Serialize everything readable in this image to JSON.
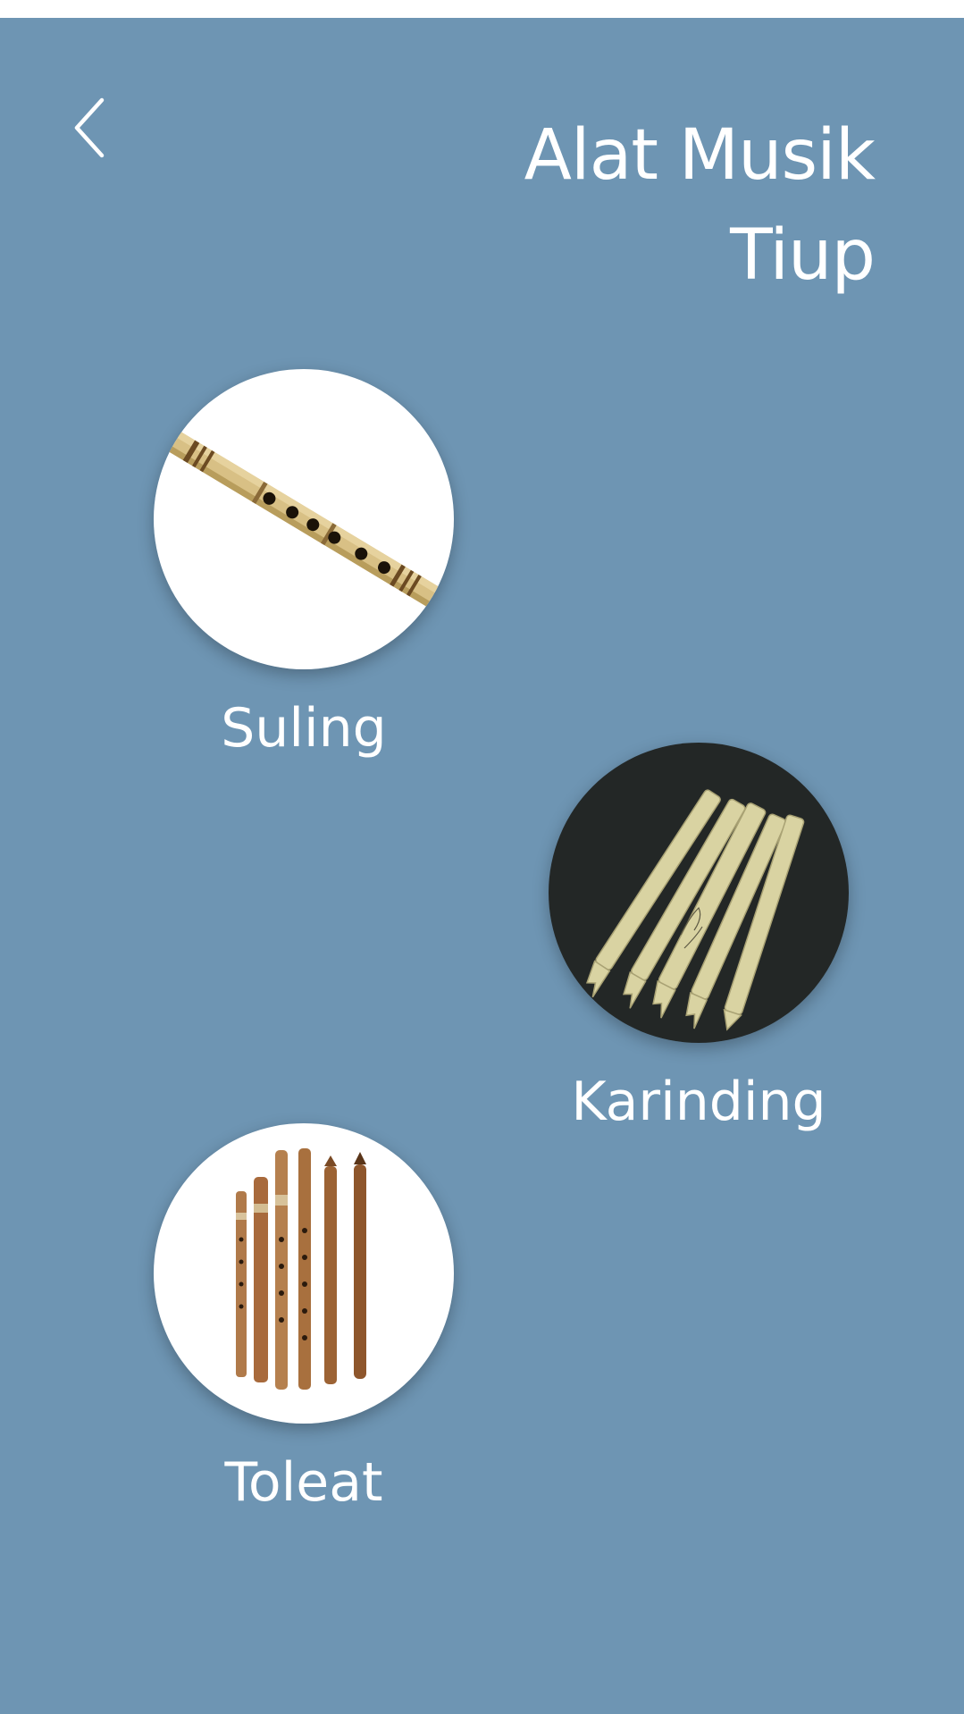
{
  "header": {
    "back_icon": "chevron-left-icon",
    "title_line1": "Alat Musik",
    "title_line2": "Tiup"
  },
  "colors": {
    "background": "#6e95b3",
    "text": "#ffffff",
    "status_bar": "#ffffff"
  },
  "instruments": [
    {
      "name": "Suling",
      "image": "suling-flute-image"
    },
    {
      "name": "Karinding",
      "image": "karinding-image"
    },
    {
      "name": "Toleat",
      "image": "toleat-image"
    }
  ]
}
